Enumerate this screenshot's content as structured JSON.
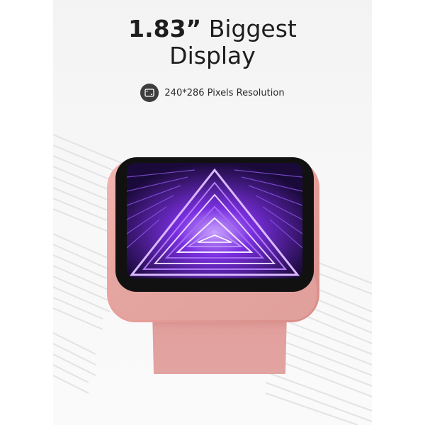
{
  "headline": {
    "size": "1.83”",
    "rest": "Biggest",
    "line2": "Display"
  },
  "feature": {
    "icon": "screen-resolution-icon",
    "text": "240*286 Pixels Resolution"
  },
  "colors": {
    "watch_body": "#e8a09c",
    "strap": "#dd9896",
    "screen_accent": "#8b3ff0",
    "icon_badge": "#3d3d3d"
  }
}
